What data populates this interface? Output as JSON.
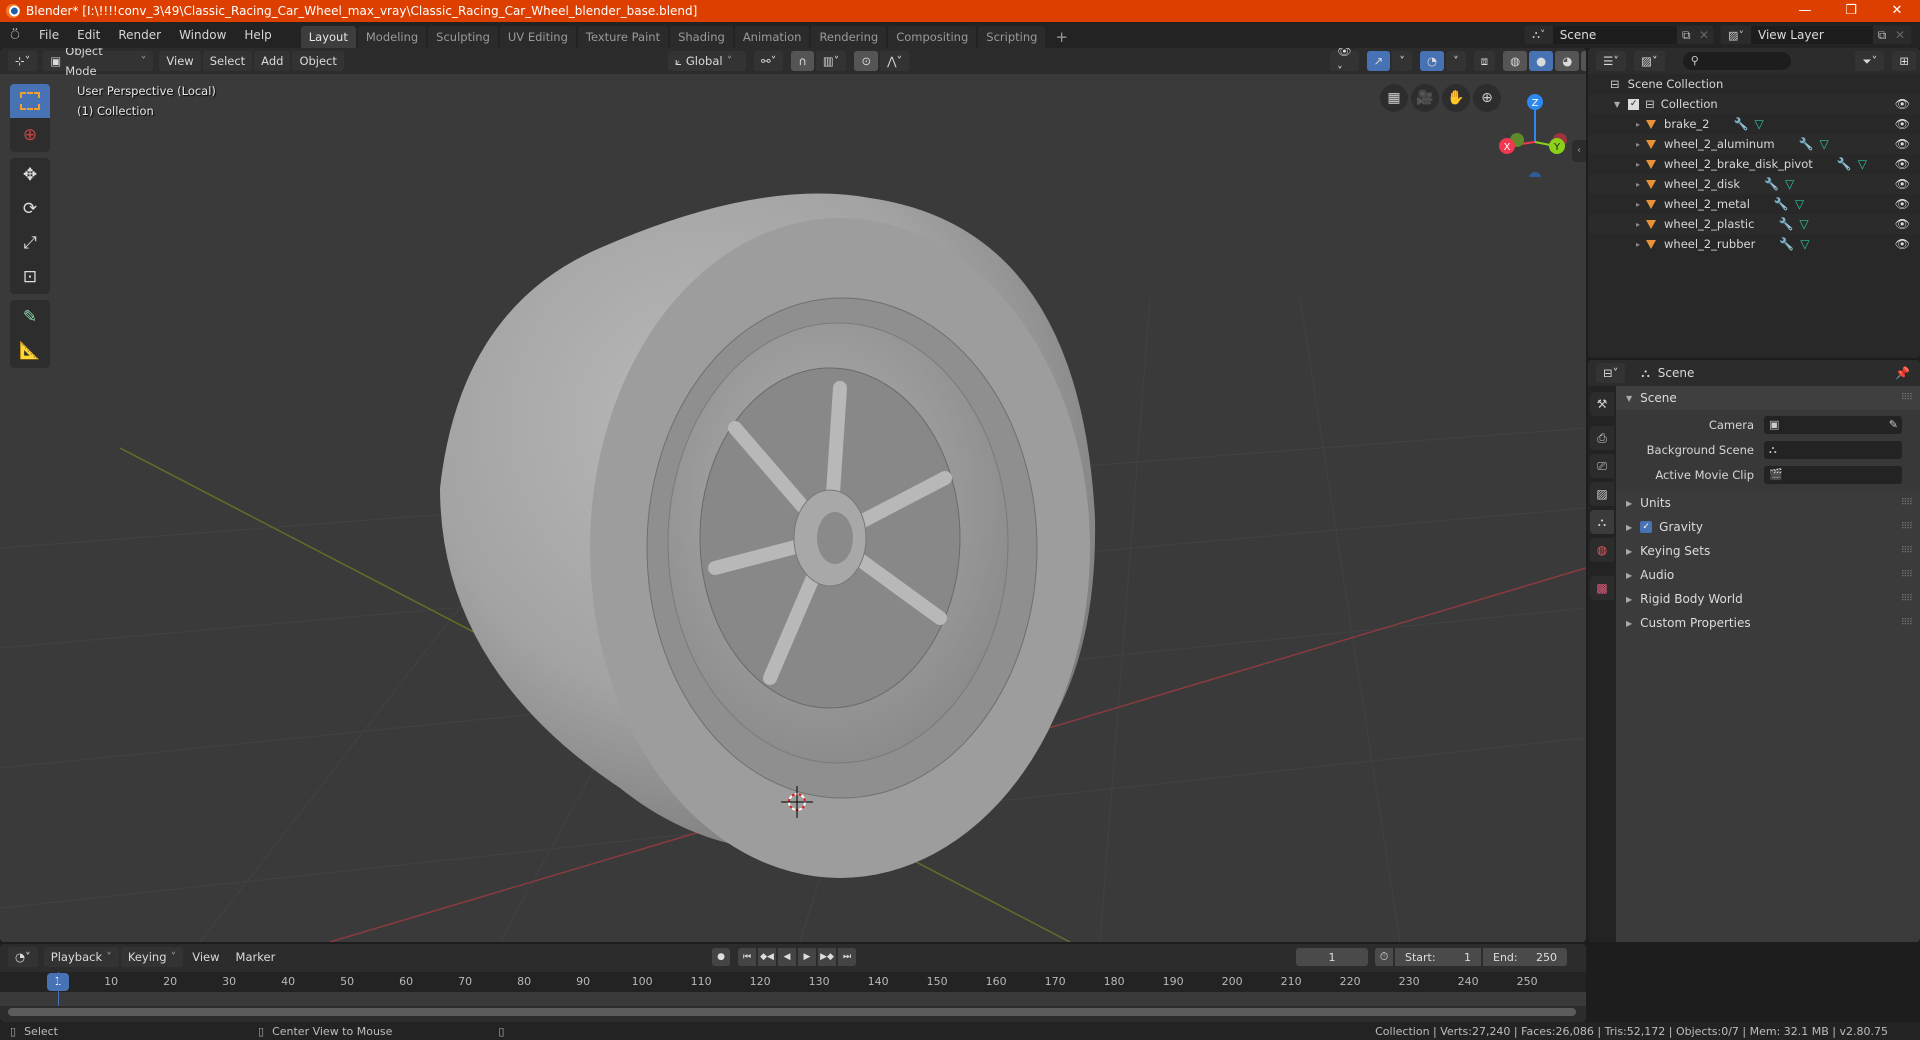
{
  "window": {
    "title": "Blender* [I:\\!!!!conv_3\\49\\Classic_Racing_Car_Wheel_max_vray\\Classic_Racing_Car_Wheel_blender_base.blend]",
    "controls": {
      "minimize": "—",
      "restore": "❐",
      "close": "✕"
    }
  },
  "topbar": {
    "menus": [
      "File",
      "Edit",
      "Render",
      "Window",
      "Help"
    ],
    "workspaces": [
      "Layout",
      "Modeling",
      "Sculpting",
      "UV Editing",
      "Texture Paint",
      "Shading",
      "Animation",
      "Rendering",
      "Compositing",
      "Scripting"
    ],
    "active_workspace": "Layout",
    "add_workspace": "+",
    "scene_name": "Scene",
    "view_layer_name": "View Layer"
  },
  "viewport": {
    "header": {
      "mode": "Object Mode",
      "menus": [
        "View",
        "Select",
        "Add",
        "Object"
      ],
      "orientation": "Global"
    },
    "overlay_text": {
      "perspective": "User Perspective (Local)",
      "collection": "(1) Collection"
    },
    "tools": [
      "select-box",
      "cursor",
      "move",
      "rotate",
      "scale",
      "transform",
      "annotate",
      "measure"
    ],
    "gizmo": {
      "x": "X",
      "y": "Y",
      "z": "Z"
    },
    "colors": {
      "x_axis": "#f0384f",
      "y_axis": "#8bd11a",
      "z_axis": "#2f87f0",
      "accent": "#4772b3"
    }
  },
  "outliner": {
    "root": "Scene Collection",
    "collection": "Collection",
    "objects": [
      {
        "name": "brake_2"
      },
      {
        "name": "wheel_2_aluminum"
      },
      {
        "name": "wheel_2_brake_disk_pivot"
      },
      {
        "name": "wheel_2_disk"
      },
      {
        "name": "wheel_2_metal"
      },
      {
        "name": "wheel_2_plastic"
      },
      {
        "name": "wheel_2_rubber"
      }
    ]
  },
  "properties": {
    "context": "Scene",
    "panel_title": "Scene",
    "fields": [
      {
        "label": "Camera",
        "value": ""
      },
      {
        "label": "Background Scene",
        "value": ""
      },
      {
        "label": "Active Movie Clip",
        "value": ""
      }
    ],
    "sections": [
      "Units",
      "Gravity",
      "Keying Sets",
      "Audio",
      "Rigid Body World",
      "Custom Properties"
    ],
    "gravity_checked": true
  },
  "timeline": {
    "menus": [
      "Playback",
      "Keying",
      "View",
      "Marker"
    ],
    "current_frame": "1",
    "start_label": "Start:",
    "start": "1",
    "end_label": "End:",
    "end": "250",
    "ticks": [
      "10",
      "20",
      "30",
      "40",
      "50",
      "60",
      "70",
      "80",
      "90",
      "100",
      "110",
      "120",
      "130",
      "140",
      "150",
      "160",
      "170",
      "180",
      "190",
      "200",
      "210",
      "220",
      "230",
      "240",
      "250"
    ],
    "cursor_frame": "1"
  },
  "statusbar": {
    "left_action": "Select",
    "middle_action": "Center View to Mouse",
    "stats": "Collection | Verts:27,240 | Faces:26,086 | Tris:52,172 | Objects:0/7 | Mem: 32.1 MB | v2.80.75"
  }
}
